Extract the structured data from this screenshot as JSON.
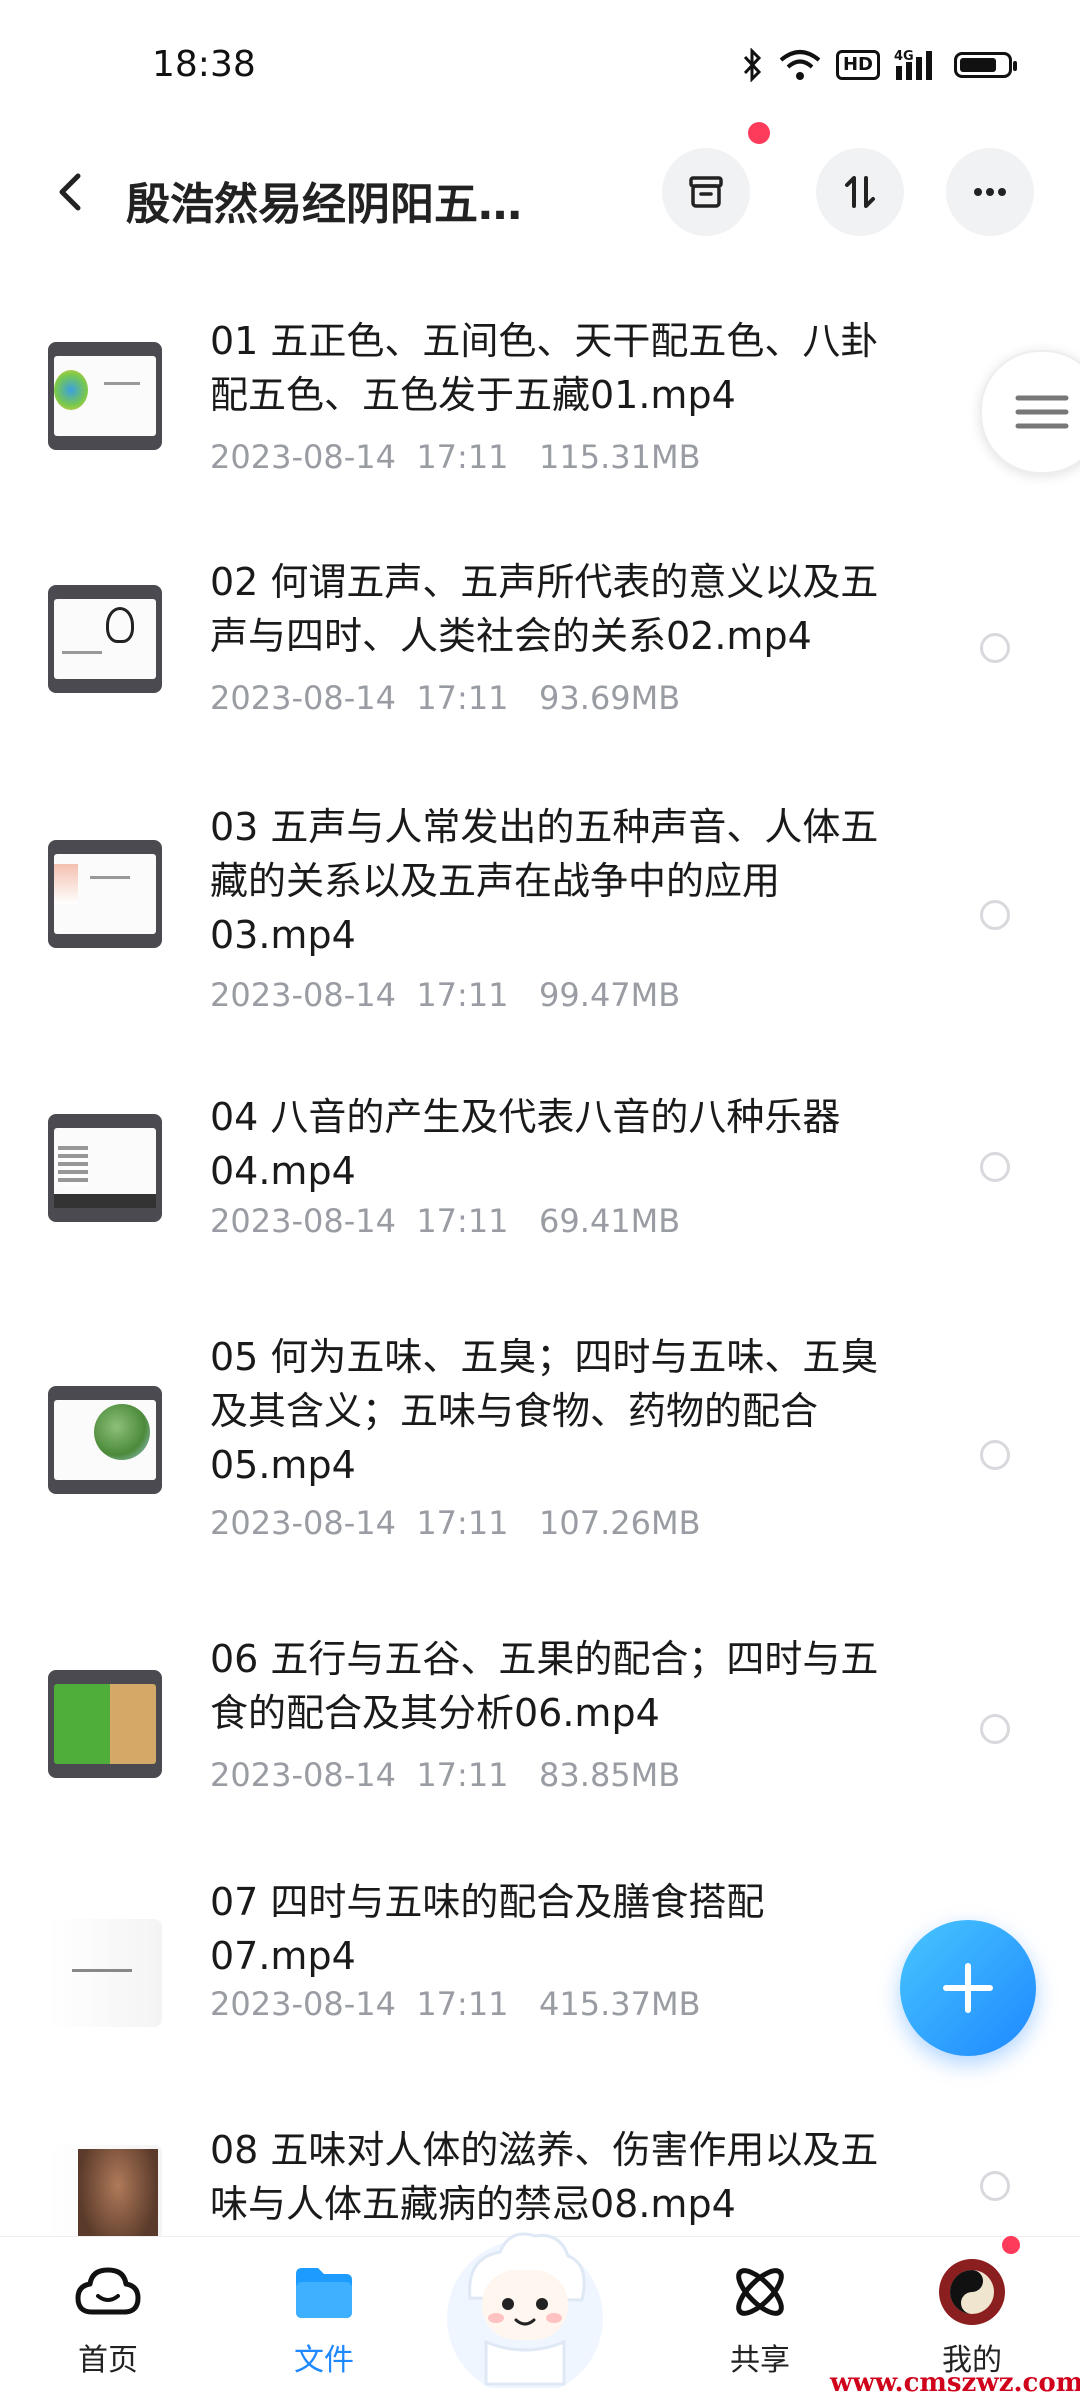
{
  "status_bar": {
    "time": "18:38",
    "icons": [
      "bluetooth-icon",
      "wifi-icon",
      "hd-icon",
      "signal-4g-icon",
      "battery-icon"
    ],
    "hd_label": "HD",
    "network_label": "4G"
  },
  "header": {
    "title": "殷浩然易经阴阳五…",
    "buttons": [
      "archive-icon",
      "sort-icon",
      "more-icon"
    ]
  },
  "files": [
    {
      "name": "01 五正色、五间色、天干配五色、八卦配五色、五色发于五藏01.mp4",
      "meta": "2023-08-14  17:11   115.31MB"
    },
    {
      "name": "02 何谓五声、五声所代表的意义以及五声与四时、人类社会的关系02.mp4",
      "meta": "2023-08-14  17:11   93.69MB"
    },
    {
      "name": "03 五声与人常发出的五种声音、人体五藏的关系以及五声在战争中的应用03.mp4",
      "meta": "2023-08-14  17:11   99.47MB"
    },
    {
      "name": "04 八音的产生及代表八音的八种乐器04.mp4",
      "meta": "2023-08-14  17:11   69.41MB"
    },
    {
      "name": "05 何为五味、五臭；四时与五味、五臭及其含义；五味与食物、药物的配合05.mp4",
      "meta": "2023-08-14  17:11   107.26MB"
    },
    {
      "name": "06 五行与五谷、五果的配合；四时与五食的配合及其分析06.mp4",
      "meta": "2023-08-14  17:11   83.85MB"
    },
    {
      "name": "07 四时与五味的配合及膳食搭配07.mp4",
      "meta": "2023-08-14  17:11   415.37MB"
    },
    {
      "name": "08 五味对人体的滋养、伤害作用以及五味与人体五藏病的禁忌08.mp4",
      "meta": ""
    }
  ],
  "nav": [
    {
      "label": "首页",
      "icon": "cloud-home-icon"
    },
    {
      "label": "文件",
      "icon": "folder-icon",
      "active": true
    },
    {
      "label": "",
      "icon": "mascot-icon"
    },
    {
      "label": "共享",
      "icon": "share-atom-icon"
    },
    {
      "label": "我的",
      "icon": "avatar-icon"
    }
  ],
  "watermark": "www.cmszwz.com",
  "colors": {
    "accent": "#1e88ff",
    "badge": "#ff3b5c",
    "meta_text": "#9a9ca3"
  }
}
